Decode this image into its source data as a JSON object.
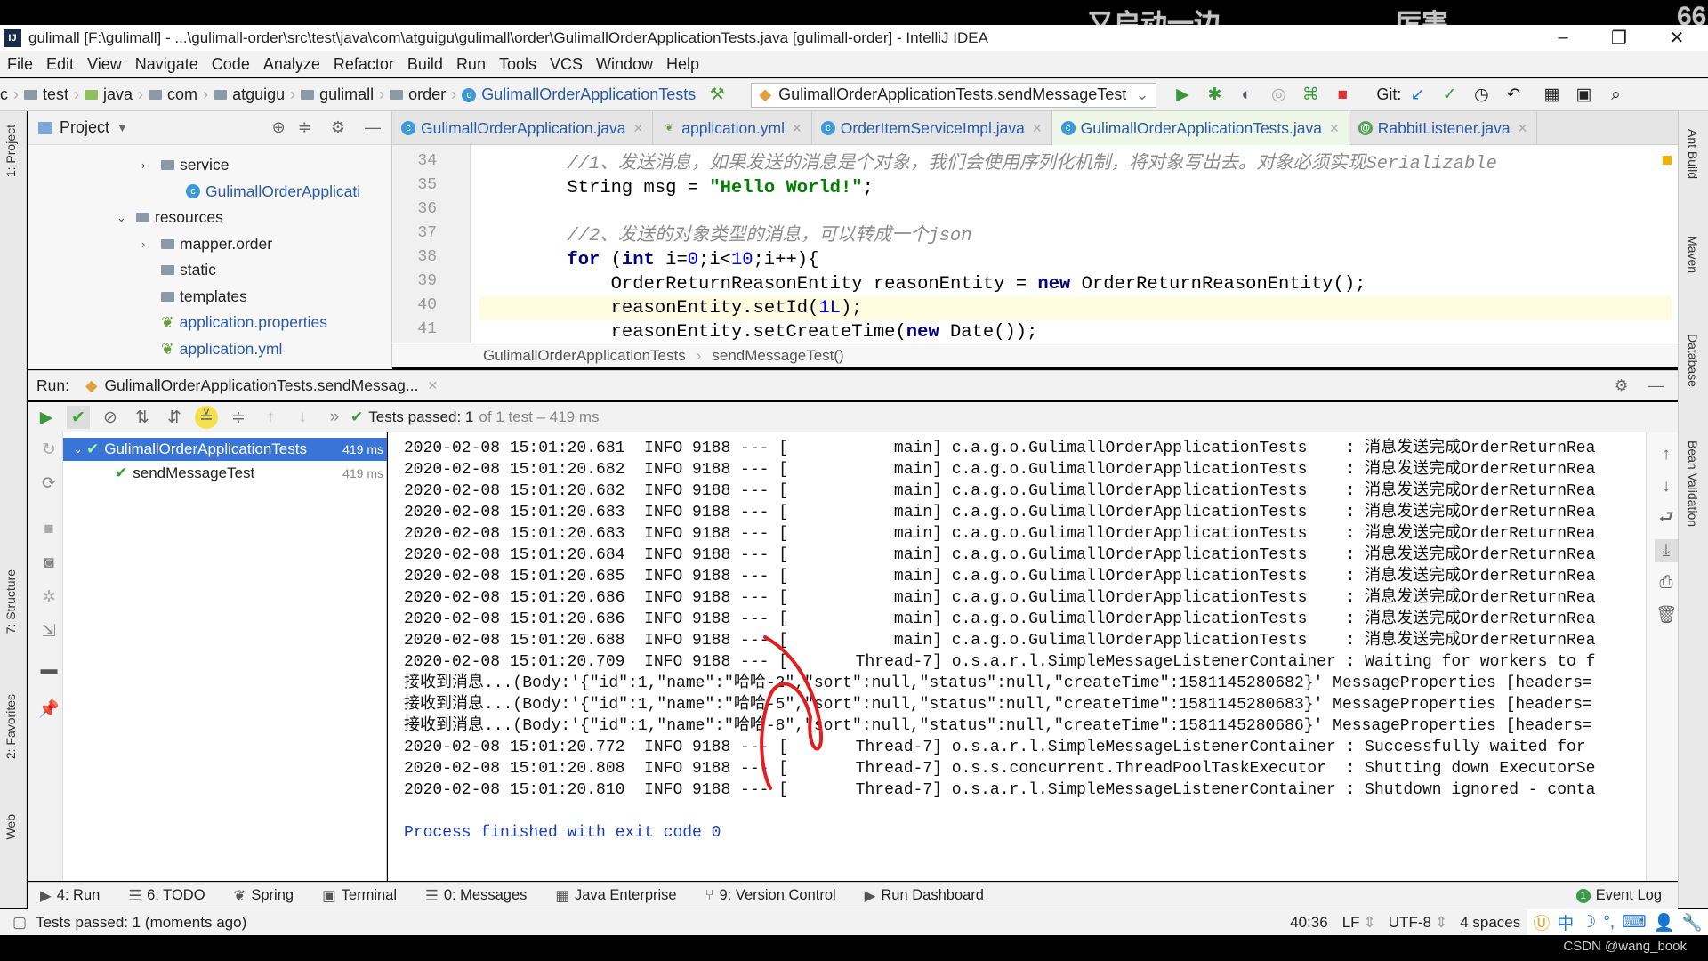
{
  "overlay": {
    "danmaku": [
      "又启动一边",
      "厉害",
      "66"
    ],
    "credit": "CSDN @wang_book"
  },
  "window": {
    "title": "gulimall [F:\\gulimall] - ...\\gulimall-order\\src\\test\\java\\com\\atguigu\\gulimall\\order\\GulimallOrderApplicationTests.java [gulimall-order] - IntelliJ IDEA",
    "logo": "IJ"
  },
  "menu": [
    "File",
    "Edit",
    "View",
    "Navigate",
    "Code",
    "Analyze",
    "Refactor",
    "Build",
    "Run",
    "Tools",
    "VCS",
    "Window",
    "Help"
  ],
  "nav": {
    "crumbs": [
      {
        "label": "c",
        "icon": "none"
      },
      {
        "label": "test",
        "icon": "folder"
      },
      {
        "label": "java",
        "icon": "folder-green"
      },
      {
        "label": "com",
        "icon": "folder"
      },
      {
        "label": "atguigu",
        "icon": "folder"
      },
      {
        "label": "gulimall",
        "icon": "folder"
      },
      {
        "label": "order",
        "icon": "folder"
      },
      {
        "label": "GulimallOrderApplicationTests",
        "icon": "class"
      }
    ],
    "run_config": "GulimallOrderApplicationTests.sendMessageTest",
    "git_label": "Git:"
  },
  "project": {
    "title": "Project",
    "items": [
      {
        "label": "service",
        "type": "folder",
        "arrow": "›",
        "indent": 1
      },
      {
        "label": "GulimallOrderApplicati",
        "type": "class",
        "arrow": "",
        "indent": 2
      },
      {
        "label": "resources",
        "type": "folder",
        "arrow": "⌄",
        "indent": 0
      },
      {
        "label": "mapper.order",
        "type": "folder",
        "arrow": "›",
        "indent": 1
      },
      {
        "label": "static",
        "type": "folder",
        "arrow": "",
        "indent": 1
      },
      {
        "label": "templates",
        "type": "folder",
        "arrow": "",
        "indent": 1
      },
      {
        "label": "application.properties",
        "type": "config",
        "arrow": "",
        "indent": 1
      },
      {
        "label": "application.yml",
        "type": "config",
        "arrow": "",
        "indent": 1
      }
    ]
  },
  "tabs": [
    {
      "label": "GulimallOrderApplication.java",
      "active": false
    },
    {
      "label": "application.yml",
      "active": false
    },
    {
      "label": "OrderItemServiceImpl.java",
      "active": false
    },
    {
      "label": "GulimallOrderApplicationTests.java",
      "active": true
    },
    {
      "label": "RabbitListener.java",
      "active": false
    }
  ],
  "editor": {
    "lines": [
      {
        "n": "34",
        "tokens": [
          {
            "t": "        //1、发送消息，如果发送的消息是个对象，我们会使用序列化机制，将对象写出去。对象必须实现Serializable",
            "k": "c"
          }
        ]
      },
      {
        "n": "35",
        "tokens": [
          {
            "t": "        String msg = ",
            "k": "p"
          },
          {
            "t": "\"Hello World!\"",
            "k": "s"
          },
          {
            "t": ";",
            "k": "p"
          }
        ]
      },
      {
        "n": "36",
        "tokens": []
      },
      {
        "n": "37",
        "tokens": [
          {
            "t": "        //2、发送的对象类型的消息，可以转成一个json",
            "k": "c"
          }
        ]
      },
      {
        "n": "38",
        "tokens": [
          {
            "t": "        for ",
            "k": "k"
          },
          {
            "t": "(",
            "k": "p"
          },
          {
            "t": "int ",
            "k": "k"
          },
          {
            "t": "i=",
            "k": "p"
          },
          {
            "t": "0",
            "k": "n"
          },
          {
            "t": ";i<",
            "k": "p"
          },
          {
            "t": "10",
            "k": "n"
          },
          {
            "t": ";i++){",
            "k": "p"
          }
        ]
      },
      {
        "n": "39",
        "tokens": [
          {
            "t": "            OrderReturnReasonEntity reasonEntity = ",
            "k": "p"
          },
          {
            "t": "new ",
            "k": "k"
          },
          {
            "t": "OrderReturnReasonEntity();",
            "k": "p"
          }
        ]
      },
      {
        "n": "40",
        "tokens": [
          {
            "t": "            reasonEntity.setId(",
            "k": "p"
          },
          {
            "t": "1L",
            "k": "n"
          },
          {
            "t": ");",
            "k": "p"
          }
        ],
        "highlight": true
      },
      {
        "n": "41",
        "tokens": [
          {
            "t": "            reasonEntity.setCreateTime(",
            "k": "p"
          },
          {
            "t": "new ",
            "k": "k"
          },
          {
            "t": "Date());",
            "k": "p"
          }
        ]
      }
    ],
    "breadcrumb": [
      "GulimallOrderApplicationTests",
      "sendMessageTest()"
    ]
  },
  "run": {
    "label": "Run:",
    "tab": "GulimallOrderApplicationTests.sendMessag...",
    "status": "Tests passed: 1",
    "status_rest": "of 1 test – 419 ms",
    "tree": [
      {
        "label": "GulimallOrderApplicationTests",
        "time": "419 ms",
        "selected": true
      },
      {
        "label": "sendMessageTest",
        "time": "419 ms",
        "selected": false
      }
    ],
    "console": [
      "2020-02-08 15:01:20.681  INFO 9188 --- [           main] c.a.g.o.GulimallOrderApplicationTests    : 消息发送完成OrderReturnRea",
      "2020-02-08 15:01:20.682  INFO 9188 --- [           main] c.a.g.o.GulimallOrderApplicationTests    : 消息发送完成OrderReturnRea",
      "2020-02-08 15:01:20.682  INFO 9188 --- [           main] c.a.g.o.GulimallOrderApplicationTests    : 消息发送完成OrderReturnRea",
      "2020-02-08 15:01:20.683  INFO 9188 --- [           main] c.a.g.o.GulimallOrderApplicationTests    : 消息发送完成OrderReturnRea",
      "2020-02-08 15:01:20.683  INFO 9188 --- [           main] c.a.g.o.GulimallOrderApplicationTests    : 消息发送完成OrderReturnRea",
      "2020-02-08 15:01:20.684  INFO 9188 --- [           main] c.a.g.o.GulimallOrderApplicationTests    : 消息发送完成OrderReturnRea",
      "2020-02-08 15:01:20.685  INFO 9188 --- [           main] c.a.g.o.GulimallOrderApplicationTests    : 消息发送完成OrderReturnRea",
      "2020-02-08 15:01:20.686  INFO 9188 --- [           main] c.a.g.o.GulimallOrderApplicationTests    : 消息发送完成OrderReturnRea",
      "2020-02-08 15:01:20.686  INFO 9188 --- [           main] c.a.g.o.GulimallOrderApplicationTests    : 消息发送完成OrderReturnRea",
      "2020-02-08 15:01:20.688  INFO 9188 --- [           main] c.a.g.o.GulimallOrderApplicationTests    : 消息发送完成OrderReturnRea",
      "2020-02-08 15:01:20.709  INFO 9188 --- [       Thread-7] o.s.a.r.l.SimpleMessageListenerContainer : Waiting for workers to f",
      "接收到消息...(Body:'{\"id\":1,\"name\":\"哈哈-2\",\"sort\":null,\"status\":null,\"createTime\":1581145280682}' MessageProperties [headers=",
      "接收到消息...(Body:'{\"id\":1,\"name\":\"哈哈-5\",\"sort\":null,\"status\":null,\"createTime\":1581145280683}' MessageProperties [headers=",
      "接收到消息...(Body:'{\"id\":1,\"name\":\"哈哈-8\",\"sort\":null,\"status\":null,\"createTime\":1581145280686}' MessageProperties [headers=",
      "2020-02-08 15:01:20.772  INFO 9188 --- [       Thread-7] o.s.a.r.l.SimpleMessageListenerContainer : Successfully waited for",
      "2020-02-08 15:01:20.808  INFO 9188 --- [       Thread-7] o.s.s.concurrent.ThreadPoolTaskExecutor  : Shutting down ExecutorSe",
      "2020-02-08 15:01:20.810  INFO 9188 --- [       Thread-7] o.s.a.r.l.SimpleMessageListenerContainer : Shutdown ignored - conta"
    ],
    "exit": "Process finished with exit code 0"
  },
  "left_stripe": [
    "1: Project",
    "7: Structure",
    "2: Favorites",
    "Web"
  ],
  "right_stripe": [
    "Ant Build",
    "Maven",
    "Database",
    "Bean Validation"
  ],
  "bottom_tabs": [
    {
      "label": "4: Run",
      "icon": "run-icon"
    },
    {
      "label": "6: TODO",
      "icon": "todo-icon"
    },
    {
      "label": "Spring",
      "icon": "spring-icon"
    },
    {
      "label": "Terminal",
      "icon": "terminal-icon"
    },
    {
      "label": "0: Messages",
      "icon": "messages-icon"
    },
    {
      "label": "Java Enterprise",
      "icon": "java-enterprise-icon"
    },
    {
      "label": "9: Version Control",
      "icon": "vcs-icon"
    },
    {
      "label": "Run Dashboard",
      "icon": "dashboard-icon"
    }
  ],
  "event_log": {
    "label": "Event Log",
    "count": "1"
  },
  "status": {
    "message": "Tests passed: 1 (moments ago)",
    "position": "40:36",
    "line_sep": "LF",
    "encoding": "UTF-8",
    "indent": "4 spaces",
    "ime": "中"
  },
  "colors": {
    "accent": "#2a5ba8",
    "selected": "#3875d7",
    "pass": "#4caf50",
    "annotation": "#e02020"
  }
}
